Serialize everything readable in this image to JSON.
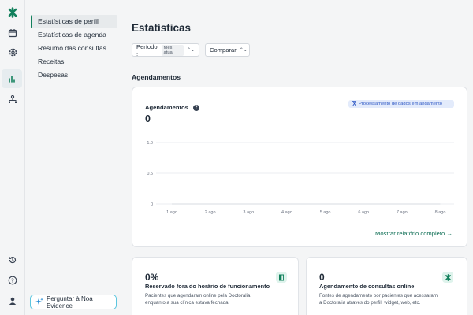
{
  "sidebar": {
    "items": [
      {
        "label": "Estatísticas de perfil",
        "active": true
      },
      {
        "label": "Estatísticas de agenda",
        "active": false
      },
      {
        "label": "Resumo das consultas",
        "active": false
      },
      {
        "label": "Receitas",
        "active": false
      },
      {
        "label": "Despesas",
        "active": false
      }
    ]
  },
  "assistant": {
    "label": "Perguntar à Noa Evidence"
  },
  "page": {
    "title": "Estatísticas"
  },
  "filters": {
    "period_label": "Período :",
    "period_value": "Mês atual",
    "compare_label": "Comparar"
  },
  "section": {
    "title": "Agendamentos"
  },
  "chart_card": {
    "title": "Agendamentos",
    "total": "0",
    "badge": "Processamento de dados em andamento",
    "link": "Mostrar relatório completo"
  },
  "chart_data": {
    "type": "line",
    "x": [
      "1 ago",
      "2 ago",
      "3 ago",
      "4 ago",
      "5 ago",
      "6 ago",
      "7 ago",
      "8 ago"
    ],
    "series": [
      {
        "values": [
          0,
          0,
          0,
          0,
          0,
          0,
          0,
          0
        ]
      }
    ],
    "yticks": [
      "1.0",
      "0.5",
      "0"
    ],
    "ylim": [
      0,
      1
    ],
    "grid": true
  },
  "stats": [
    {
      "value": "0%",
      "label": "Reservado fora do horário de funcionamento",
      "desc": "Pacientes que agendaram online pela Doctoralia enquanto a sua clínica estava fechada"
    },
    {
      "value": "0",
      "label": "Agendamento de consultas online",
      "desc": "Fontes de agendamento por pacientes que acessaram a Doctoralia através do perfil, widget, web, etc."
    }
  ],
  "colors": {
    "brand": "#12805c",
    "accent": "#5cc6df",
    "badge_bg": "#e3ebfb",
    "badge_text": "#2d57c4"
  }
}
